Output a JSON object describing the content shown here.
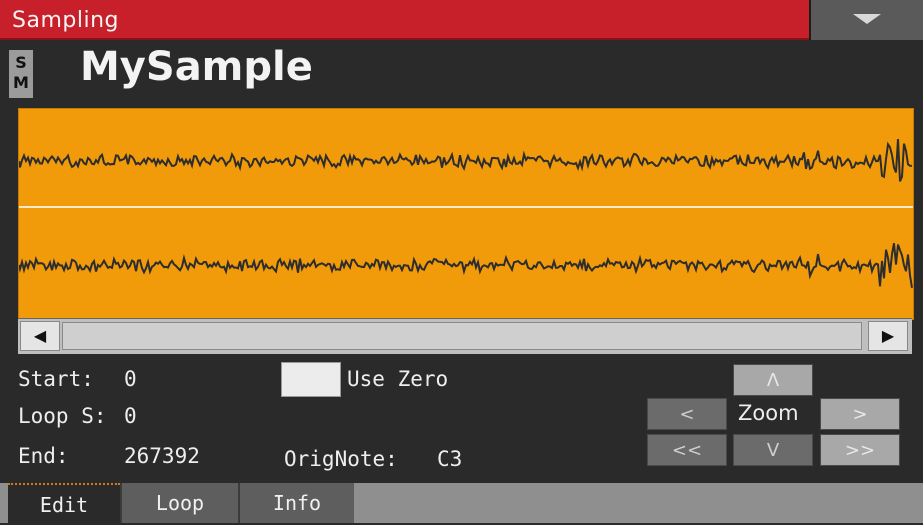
{
  "window": {
    "title": "Sampling"
  },
  "sample": {
    "badge_top": "S",
    "badge_bottom": "M",
    "name": "MySample"
  },
  "waveform": {
    "background": "#f29b0a",
    "trace_color": "#2d2d2d"
  },
  "scrollbar": {
    "left_arrow": "◀",
    "right_arrow": "▶"
  },
  "params": {
    "start_label": "Start:",
    "start_value": "0",
    "loop_label": "Loop S:",
    "loop_value": "0",
    "end_label": "End:",
    "end_value": "267392",
    "use_zero_label": "Use Zero",
    "orig_note_label": "OrigNote:",
    "orig_note_value": "C3"
  },
  "zoom": {
    "label": "Zoom",
    "up": "Λ",
    "down": "V",
    "left": "<",
    "right": ">",
    "left_fast": "<<",
    "right_fast": ">>"
  },
  "tabs": [
    {
      "label": "Edit",
      "active": true
    },
    {
      "label": "Loop",
      "active": false
    },
    {
      "label": "Info",
      "active": false
    }
  ]
}
